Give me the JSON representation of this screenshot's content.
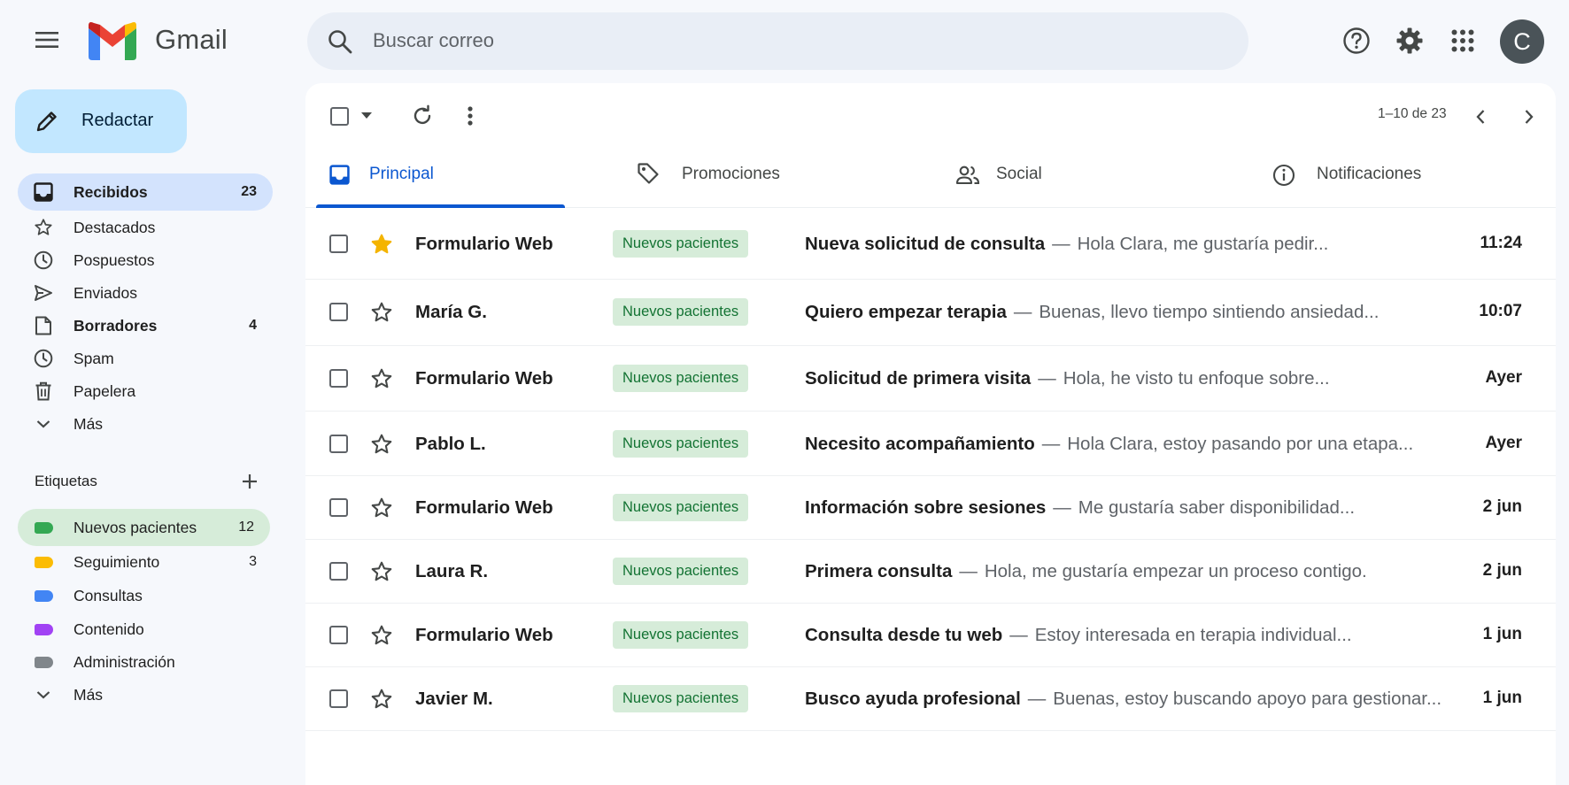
{
  "header": {
    "brand": "Gmail",
    "search_placeholder": "Buscar correo",
    "avatar_letter": "C"
  },
  "sidebar": {
    "compose_label": "Redactar",
    "items": [
      {
        "label": "Recibidos",
        "count": "23"
      },
      {
        "label": "Destacados",
        "count": ""
      },
      {
        "label": "Pospuestos",
        "count": ""
      },
      {
        "label": "Enviados",
        "count": ""
      },
      {
        "label": "Borradores",
        "count": "4"
      },
      {
        "label": "Spam",
        "count": ""
      },
      {
        "label": "Papelera",
        "count": ""
      },
      {
        "label": "Más",
        "count": ""
      }
    ],
    "labels_title": "Etiquetas",
    "labels": [
      {
        "label": "Nuevos pacientes",
        "count": "12",
        "color": "#34a853"
      },
      {
        "label": "Seguimiento",
        "count": "3",
        "color": "#fbbc04"
      },
      {
        "label": "Consultas",
        "count": "",
        "color": "#4285f4"
      },
      {
        "label": "Contenido",
        "count": "",
        "color": "#a142f4"
      },
      {
        "label": "Administración",
        "count": "",
        "color": "#80868b"
      }
    ],
    "labels_more": "Más"
  },
  "toolbar": {
    "pagination": "1–10 de 23"
  },
  "tabs": [
    {
      "label": "Principal"
    },
    {
      "label": "Promociones"
    },
    {
      "label": "Social"
    },
    {
      "label": "Notificaciones"
    }
  ],
  "emails": [
    {
      "sender": "Formulario Web",
      "label": "Nuevos pacientes",
      "subject": "Nueva solicitud de consulta",
      "snippet": "Hola Clara, me gustaría pedir...",
      "time": "11:24",
      "starred": true
    },
    {
      "sender": "María G.",
      "label": "Nuevos pacientes",
      "subject": "Quiero empezar terapia",
      "snippet": "Buenas, llevo tiempo sintiendo ansiedad...",
      "time": "10:07",
      "starred": false
    },
    {
      "sender": "Formulario Web",
      "label": "Nuevos pacientes",
      "subject": "Solicitud de primera visita",
      "snippet": "Hola, he visto tu enfoque sobre...",
      "time": "Ayer",
      "starred": false
    },
    {
      "sender": "Pablo L.",
      "label": "Nuevos pacientes",
      "subject": "Necesito acompañamiento",
      "snippet": "Hola Clara, estoy pasando por una etapa...",
      "time": "Ayer",
      "starred": false
    },
    {
      "sender": "Formulario Web",
      "label": "Nuevos pacientes",
      "subject": "Información sobre sesiones",
      "snippet": "Me gustaría saber disponibilidad...",
      "time": "2 jun",
      "starred": false
    },
    {
      "sender": "Laura R.",
      "label": "Nuevos pacientes",
      "subject": "Primera consulta",
      "snippet": "Hola, me gustaría empezar un proceso contigo.",
      "time": "2 jun",
      "starred": false
    },
    {
      "sender": "Formulario Web",
      "label": "Nuevos pacientes",
      "subject": "Consulta desde tu web",
      "snippet": "Estoy interesada en terapia individual...",
      "time": "1 jun",
      "starred": false
    },
    {
      "sender": "Javier M.",
      "label": "Nuevos pacientes",
      "subject": "Busco ayuda profesional",
      "snippet": "Buenas, estoy buscando apoyo para gestionar...",
      "time": "1 jun",
      "starred": false
    }
  ],
  "colors": {
    "accent": "#0b57d0",
    "compose_bg": "#c2e7ff",
    "label_chip_bg": "#d6ecd9",
    "label_chip_text": "#137333",
    "star": "#f4b400"
  }
}
